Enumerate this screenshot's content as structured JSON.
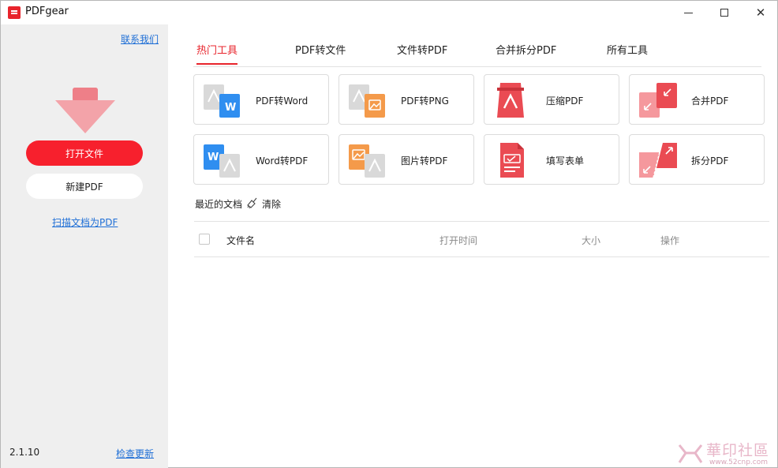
{
  "window": {
    "title": "PDFgear"
  },
  "window_controls": {
    "minimize": "",
    "maximize": "",
    "close": "✕"
  },
  "sidebar": {
    "contact": "联系我们",
    "open_file": "打开文件",
    "new_pdf": "新建PDF",
    "scan": "扫描文档为PDF",
    "version": "2.1.10",
    "check_update": "检查更新"
  },
  "tabs": [
    {
      "label": "热门工具",
      "active": true
    },
    {
      "label": "PDF转文件",
      "active": false
    },
    {
      "label": "文件转PDF",
      "active": false
    },
    {
      "label": "合并拆分PDF",
      "active": false
    },
    {
      "label": "所有工具",
      "active": false
    }
  ],
  "tools": [
    {
      "label": "PDF转Word",
      "icon": "pdf-to-word-icon"
    },
    {
      "label": "PDF转PNG",
      "icon": "pdf-to-png-icon"
    },
    {
      "label": "压缩PDF",
      "icon": "compress-pdf-icon"
    },
    {
      "label": "合并PDF",
      "icon": "merge-pdf-icon"
    },
    {
      "label": "Word转PDF",
      "icon": "word-to-pdf-icon"
    },
    {
      "label": "图片转PDF",
      "icon": "image-to-pdf-icon"
    },
    {
      "label": "填写表单",
      "icon": "fill-form-icon"
    },
    {
      "label": "拆分PDF",
      "icon": "split-pdf-icon"
    }
  ],
  "recent": {
    "title": "最近的文档",
    "clear": "清除",
    "columns": {
      "name": "文件名",
      "opened": "打开时间",
      "size": "大小",
      "actions": "操作"
    }
  },
  "watermark": {
    "text": "華印社區",
    "url": "www.52cnp.com"
  },
  "colors": {
    "accent": "#e8242c",
    "button_red": "#f7202d",
    "link": "#1f6fd6",
    "sidebar_bg": "#efefef"
  }
}
